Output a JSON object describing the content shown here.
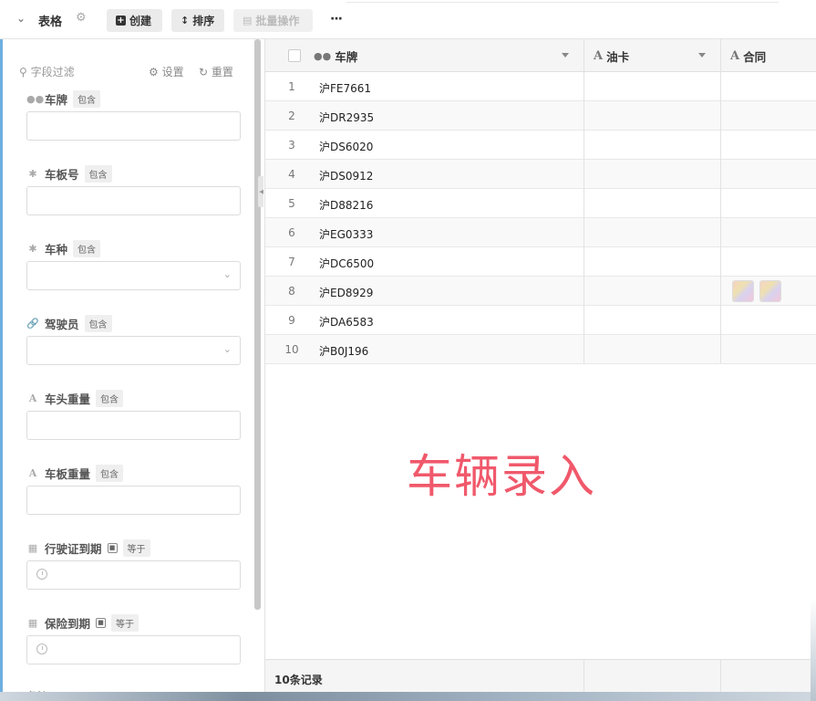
{
  "toolbar": {
    "title": "表格",
    "create_label": "创建",
    "sort_label": "排序",
    "batch_label": "批量操作",
    "more_label": "···"
  },
  "filter_panel": {
    "search_placeholder": "字段过滤",
    "settings_label": "设置",
    "reset_label": "重置",
    "fields": [
      {
        "label": "车牌",
        "op": "包含",
        "icon": "bicycle-icon",
        "type": "text"
      },
      {
        "label": "车板号",
        "op": "包含",
        "icon": "asterisk-icon",
        "type": "text"
      },
      {
        "label": "车种",
        "op": "包含",
        "icon": "asterisk-icon",
        "type": "select"
      },
      {
        "label": "驾驶员",
        "op": "包含",
        "icon": "link-icon",
        "type": "select"
      },
      {
        "label": "车头重量",
        "op": "包含",
        "icon": "text-a-icon",
        "type": "text"
      },
      {
        "label": "车板重量",
        "op": "包含",
        "icon": "text-a-icon",
        "type": "text"
      },
      {
        "label": "行驶证到期",
        "op": "等于",
        "icon": "calendar-icon",
        "type": "date"
      },
      {
        "label": "保险到期",
        "op": "等于",
        "icon": "calendar-icon",
        "type": "date"
      }
    ],
    "cut_off_label": "备注"
  },
  "grid": {
    "columns": [
      {
        "label": "车牌",
        "icon": "bicycle-icon"
      },
      {
        "label": "油卡",
        "icon": "text-a-icon"
      },
      {
        "label": "合同",
        "icon": "text-a-icon"
      }
    ],
    "rows": [
      {
        "index": "1",
        "plate": "沪FE7661"
      },
      {
        "index": "2",
        "plate": "沪DR2935"
      },
      {
        "index": "3",
        "plate": "沪DS6020"
      },
      {
        "index": "4",
        "plate": "沪DS0912"
      },
      {
        "index": "5",
        "plate": "沪D88216"
      },
      {
        "index": "6",
        "plate": "沪EG0333"
      },
      {
        "index": "7",
        "plate": "沪DC6500"
      },
      {
        "index": "8",
        "plate": "沪ED8929",
        "contract_thumbnails": 2
      },
      {
        "index": "9",
        "plate": "沪DA6583"
      },
      {
        "index": "10",
        "plate": "沪B0J196"
      }
    ],
    "record_count": "10条记录"
  },
  "overlay_text": "车辆录入",
  "colors": {
    "accent_left_border": "#6dafe0",
    "overlay_text": "#f0596b"
  }
}
